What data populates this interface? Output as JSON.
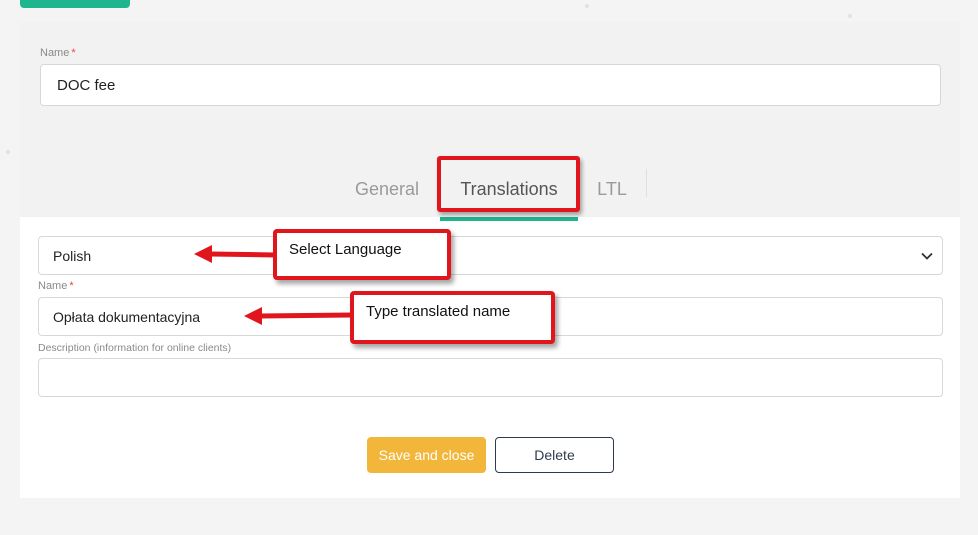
{
  "colors": {
    "accent": "#1fb58f",
    "highlight": "#e1161d",
    "primary_button": "#f2b63a",
    "secondary_border": "#2e3b4e",
    "required_marker": "#e2454d"
  },
  "main_form": {
    "name_label": "Name",
    "required_marker": "*",
    "name_value": "DOC fee"
  },
  "tabs": {
    "items": [
      {
        "label": "General",
        "active": false
      },
      {
        "label": "Translations",
        "active": true
      },
      {
        "label": "LTL",
        "active": false
      }
    ]
  },
  "translations": {
    "language_value": "Polish",
    "language_dropdown_icon": "chevron-down-icon",
    "name_label": "Name",
    "name_value": "Opłata dokumentacyjna",
    "description_label": "Description (information for online clients)",
    "description_value": ""
  },
  "annotations": {
    "select_language": "Select Language",
    "type_name": "Type translated name"
  },
  "buttons": {
    "save_and_close": "Save and close",
    "delete": "Delete"
  }
}
